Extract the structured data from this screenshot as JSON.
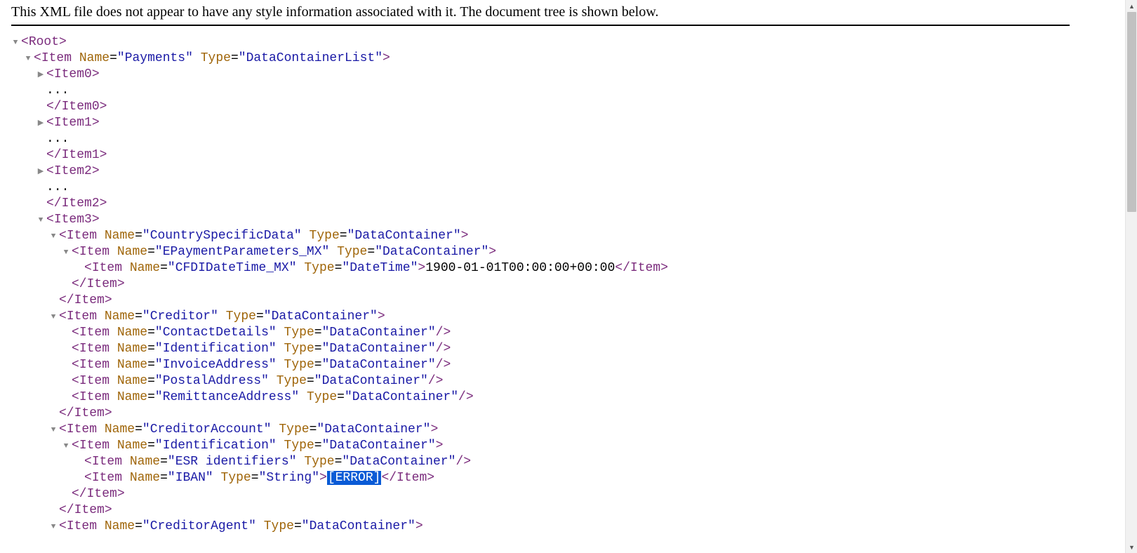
{
  "header": "This XML file does not appear to have any style information associated with it. The document tree is shown below.",
  "toggles": {
    "down": "▼",
    "right": "▶"
  },
  "root": "Root",
  "payments": {
    "tag": "Item",
    "name": "Payments",
    "type": "DataContainerList"
  },
  "item0": {
    "open": "Item0",
    "ellipsis": "...",
    "close": "Item0"
  },
  "item1": {
    "open": "Item1",
    "ellipsis": "...",
    "close": "Item1"
  },
  "item2": {
    "open": "Item2",
    "ellipsis": "...",
    "close": "Item2"
  },
  "item3open": "Item3",
  "csd": {
    "tag": "Item",
    "name": "CountrySpecificData",
    "type": "DataContainer"
  },
  "epay": {
    "tag": "Item",
    "name": "EPaymentParameters_MX",
    "type": "DataContainer"
  },
  "cfdi": {
    "tag": "Item",
    "name": "CFDIDateTime_MX",
    "type": "DateTime",
    "value": "1900-01-01T00:00:00+00:00"
  },
  "closeItem": "Item",
  "creditor": {
    "tag": "Item",
    "name": "Creditor",
    "type": "DataContainer"
  },
  "creditor_children": [
    {
      "name": "ContactDetails",
      "type": "DataContainer"
    },
    {
      "name": "Identification",
      "type": "DataContainer"
    },
    {
      "name": "InvoiceAddress",
      "type": "DataContainer"
    },
    {
      "name": "PostalAddress",
      "type": "DataContainer"
    },
    {
      "name": "RemittanceAddress",
      "type": "DataContainer"
    }
  ],
  "creditorAccount": {
    "tag": "Item",
    "name": "CreditorAccount",
    "type": "DataContainer"
  },
  "identification": {
    "tag": "Item",
    "name": "Identification",
    "type": "DataContainer"
  },
  "esr": {
    "tag": "Item",
    "name": "ESR identifiers",
    "type": "DataContainer"
  },
  "iban": {
    "tag": "Item",
    "name": "IBAN",
    "type": "String",
    "value": "[ERROR]"
  },
  "creditorAgent": {
    "tag": "Item",
    "name": "CreditorAgent",
    "type": "DataContainer"
  },
  "scroll": {
    "up": "▲",
    "down": "▼"
  }
}
